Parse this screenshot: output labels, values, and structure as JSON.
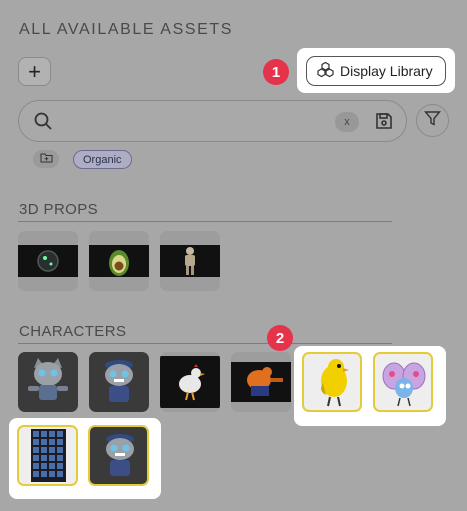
{
  "panel": {
    "title": "ALL AVAILABLE ASSETS"
  },
  "toolbar": {
    "add_label": "+",
    "display_library_label": "Display Library"
  },
  "steps": [
    "1",
    "2"
  ],
  "search": {
    "value": "",
    "clear_label": "x"
  },
  "chips": {
    "tag_label": "Organic"
  },
  "sections": {
    "props_title": "3D PROPS",
    "characters_title": "CHARACTERS"
  },
  "props": [
    {
      "name": "robot-sphere-thumbnail"
    },
    {
      "name": "avocado-thumbnail"
    },
    {
      "name": "astronaut-thumbnail"
    }
  ],
  "characters": [
    {
      "name": "cat-character-thumbnail",
      "selected": false
    },
    {
      "name": "angry-cat-character-thumbnail",
      "selected": false
    },
    {
      "name": "chicken-character-thumbnail",
      "selected": false
    },
    {
      "name": "orange-creature-thumbnail",
      "selected": false
    },
    {
      "name": "yellow-bird-thumbnail",
      "selected": true
    },
    {
      "name": "butterfly-thumbnail",
      "selected": true
    },
    {
      "name": "sprite-sheet-thumbnail",
      "selected": true
    },
    {
      "name": "angry-cat-character-thumbnail-2",
      "selected": true
    }
  ],
  "colors": {
    "highlight": "#ffffff",
    "badge": "#e5334b",
    "selection_border": "#e4cb3a",
    "background": "#a7a7a7"
  }
}
